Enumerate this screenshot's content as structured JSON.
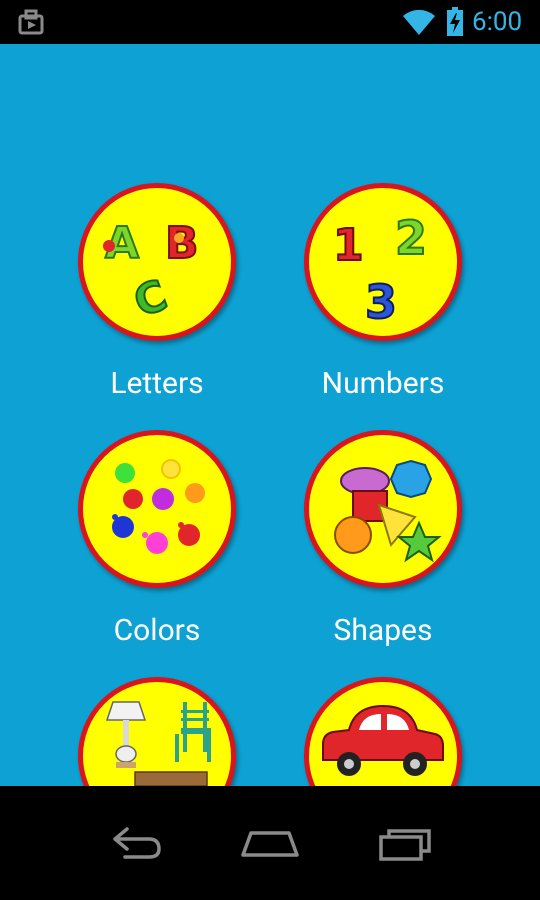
{
  "status_bar": {
    "time": "6:00",
    "icons": [
      "notification-icon",
      "wifi-icon",
      "battery-charging-icon"
    ],
    "time_color": "#33b5e5"
  },
  "menu": {
    "background": "#0ea2d4",
    "circle_fill": "#ffff00",
    "circle_border": "#d9141c",
    "tiles": [
      {
        "label": "Letters",
        "icon": "letters-icon"
      },
      {
        "label": "Numbers",
        "icon": "numbers-icon"
      },
      {
        "label": "Colors",
        "icon": "colors-icon"
      },
      {
        "label": "Shapes",
        "icon": "shapes-icon"
      },
      {
        "label": "",
        "icon": "furniture-icon"
      },
      {
        "label": "",
        "icon": "car-icon"
      }
    ]
  },
  "nav_bar": {
    "buttons": [
      "back-icon",
      "home-icon",
      "recent-apps-icon"
    ]
  }
}
